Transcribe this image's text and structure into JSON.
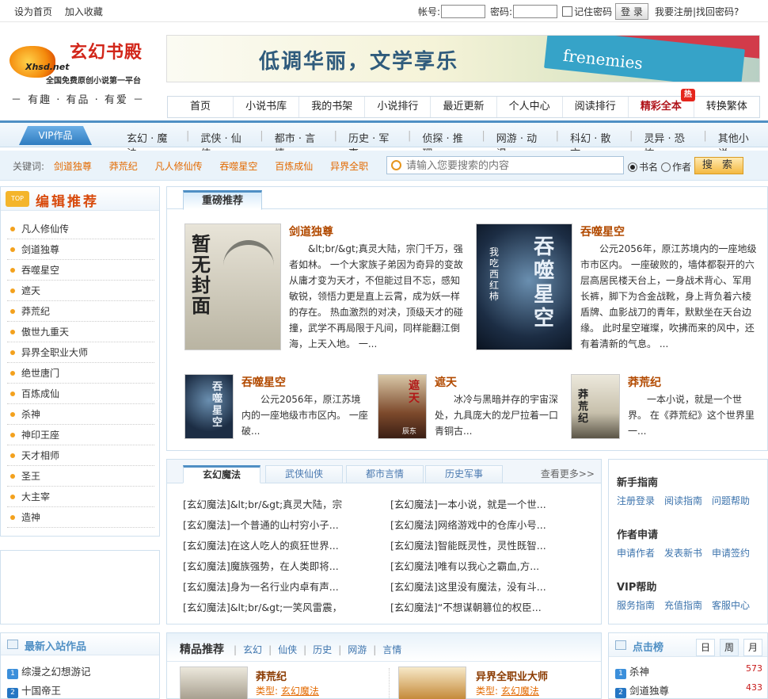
{
  "topbar": {
    "set_home": "设为首页",
    "add_fav": "加入收藏",
    "account_label": "帐号:",
    "password_label": "密码:",
    "remember": "记住密码",
    "login_btn": "登 录",
    "register": "我要注册",
    "divider": "|",
    "recover": "找回密码?"
  },
  "logo": {
    "brand": "玄幻书殿",
    "domain": "Xhsd.net",
    "tagline": "全国免费原创小说第一平台",
    "slogan": "－ 有趣 · 有品 · 有爱 －"
  },
  "banner": {
    "text": "低调华丽，文学享乐",
    "book_title": "frenemies"
  },
  "mainnav": [
    {
      "label": "首页"
    },
    {
      "label": "小说书库"
    },
    {
      "label": "我的书架"
    },
    {
      "label": "小说排行"
    },
    {
      "label": "最近更新"
    },
    {
      "label": "个人中心"
    },
    {
      "label": "阅读排行"
    },
    {
      "label": "精彩全本",
      "badge": "热"
    },
    {
      "label": "转换繁体"
    }
  ],
  "catbar": {
    "vip": "VIP作品",
    "cats": [
      "玄幻 · 魔法",
      "武侠 · 仙侠",
      "都市 · 言情",
      "历史 · 军事",
      "侦探 · 推理",
      "网游 · 动漫",
      "科幻 · 散文",
      "灵异 · 恐怖",
      "其他小说"
    ]
  },
  "search": {
    "keywords_label": "关键词:",
    "keywords": [
      "剑道独尊",
      "莽荒纪",
      "凡人修仙传",
      "吞噬星空",
      "百炼成仙",
      "异界全职"
    ],
    "placeholder": "请输入您要搜索的内容",
    "opt1": "书名",
    "opt2": "作者",
    "button": "搜 索"
  },
  "editor": {
    "title": "编辑推荐",
    "badge": "TOP",
    "items": [
      "凡人修仙传",
      "剑道独尊",
      "吞噬星空",
      "遮天",
      "莽荒纪",
      "傲世九重天",
      "异界全职业大师",
      "绝世唐门",
      "百炼成仙",
      "杀神",
      "神印王座",
      "天才相师",
      "圣王",
      "大主宰",
      "造神"
    ]
  },
  "featured": {
    "tab": "重磅推荐",
    "big": [
      {
        "title": "剑道独尊",
        "cover": "暂无封面",
        "desc": "&lt;br/&gt;真灵大陆，宗门千万，强者如林。 一个大家族子弟因为奇异的变故从庸才变为天才，不但能过目不忘，感知敏锐，领悟力更是直上云霄，成为妖一样的存在。 热血激烈的对决，顶级天才的碰撞，武学不再局限于凡间，同样能翻江倒海，上天入地。 一..."
      },
      {
        "title": "吞噬星空",
        "cover": "吞噬星空",
        "cover_sub": "我吃西红柿",
        "desc": "公元2056年，原江苏境内的一座地级市市区内。 一座破败的，墙体都裂开的六层高居民楼天台上，一身战术背心、军用长裤，脚下为合金战靴，身上背负着六棱盾牌、血影战刀的青年，默默坐在天台边缘。 此时星空璀璨，吹拂而来的风中，还有着清新的气息。 ..."
      }
    ],
    "small": [
      {
        "title": "吞噬星空",
        "cover": "吞噬星空",
        "desc": "公元2056年，原江苏境内的一座地级市市区内。 一座破..."
      },
      {
        "title": "遮天",
        "cover": "遮天",
        "cover_sub": "辰东",
        "desc": "冰冷与黑暗并存的宇宙深处，九具庞大的龙尸拉着一口青铜古..."
      },
      {
        "title": "莽荒纪",
        "cover": "莽荒纪",
        "desc": "一本小说，就是一个世界。 在《莽荒纪》这个世界里一..."
      }
    ]
  },
  "catmod": {
    "tabs": [
      "玄幻魔法",
      "武侠仙侠",
      "都市言情",
      "历史军事"
    ],
    "more": "查看更多>>",
    "left": [
      {
        "tag": "[玄幻魔法]",
        "text": "&lt;br/&gt;真灵大陆，宗"
      },
      {
        "tag": "[玄幻魔法]",
        "text": "一个普通的山村穷小子..."
      },
      {
        "tag": "[玄幻魔法]",
        "text": "在这人吃人的疯狂世界..."
      },
      {
        "tag": "[玄幻魔法]",
        "text": "魔族强势，在人类即将..."
      },
      {
        "tag": "[玄幻魔法]",
        "text": "身为一名行业内卓有声..."
      },
      {
        "tag": "[玄幻魔法]",
        "text": "&lt;br/&gt;一笑风雷震，"
      }
    ],
    "right": [
      {
        "tag": "[玄幻魔法]",
        "text": "一本小说，就是一个世..."
      },
      {
        "tag": "[玄幻魔法]",
        "text": "网络游戏中的仓库小号..."
      },
      {
        "tag": "[玄幻魔法]",
        "text": "智能既灵性，灵性既智..."
      },
      {
        "tag": "[玄幻魔法]",
        "text": "唯有以我心之霸血,方..."
      },
      {
        "tag": "[玄幻魔法]",
        "text": "这里没有魔法，没有斗..."
      },
      {
        "tag": "[玄幻魔法]",
        "text": "“不想谋朝篡位的权臣..."
      }
    ]
  },
  "guide": [
    {
      "title": "新手指南",
      "links": [
        "注册登录",
        "阅读指南",
        "问题帮助"
      ]
    },
    {
      "title": "作者申请",
      "links": [
        "申请作者",
        "发表新书",
        "申请签约"
      ]
    },
    {
      "title": "VIP帮助",
      "links": [
        "服务指南",
        "充值指南",
        "客服中心"
      ]
    }
  ],
  "newbooks": {
    "title": "最新入站作品",
    "items": [
      {
        "n": "1",
        "name": "综漫之幻想游记"
      },
      {
        "n": "2",
        "name": "十国帝王"
      }
    ]
  },
  "jingpin": {
    "title": "精品推荐",
    "cats": [
      "玄幻",
      "仙侠",
      "历史",
      "网游",
      "言情"
    ],
    "books": [
      {
        "title": "莽荒纪",
        "type_label": "类型:",
        "type": "玄幻魔法"
      },
      {
        "title": "异界全职业大师",
        "type_label": "类型:",
        "type": "玄幻魔法"
      }
    ]
  },
  "ranking": {
    "title": "点击榜",
    "tabs": [
      "日",
      "周",
      "月"
    ],
    "items": [
      {
        "n": "1",
        "name": "杀神",
        "count": "573"
      },
      {
        "n": "2",
        "name": "剑道独尊",
        "count": "433"
      }
    ]
  }
}
